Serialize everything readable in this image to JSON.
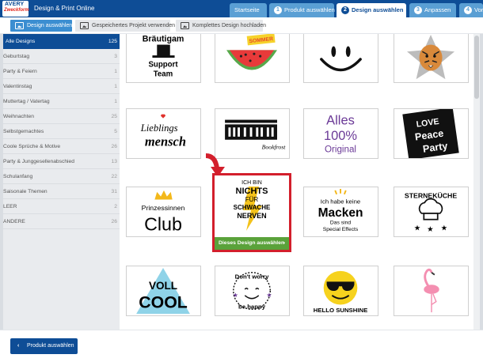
{
  "app": {
    "logo_line1": "AVERY",
    "logo_line2": "Zweckform",
    "title": "Design & Print Online"
  },
  "steps": [
    {
      "label": "Startseite",
      "number": ""
    },
    {
      "label": "Produkt auswählen",
      "number": "1"
    },
    {
      "label": "Design auswählen",
      "number": "2",
      "active": true
    },
    {
      "label": "Anpassen",
      "number": "3"
    },
    {
      "label": "Vors",
      "number": "4"
    }
  ],
  "toolbar": {
    "buttons": [
      {
        "label": "Design auswählen",
        "active": true
      },
      {
        "label": "Gespeichertes Projekt verwenden",
        "active": false
      },
      {
        "label": "Komplettes Design hochladen",
        "active": false
      }
    ]
  },
  "categories": [
    {
      "name": "Alle Designs",
      "count": "125",
      "active": true
    },
    {
      "name": "Geburtstag",
      "count": "3"
    },
    {
      "name": "Party & Feiern",
      "count": "1"
    },
    {
      "name": "Valentinstag",
      "count": "1"
    },
    {
      "name": "Muttertag / Vatertag",
      "count": "1"
    },
    {
      "name": "Weihnachten",
      "count": "25"
    },
    {
      "name": "Selbstgemachtes",
      "count": "5"
    },
    {
      "name": "Coole Sprüche & Motive",
      "count": "26"
    },
    {
      "name": "Party & Junggesellenabschied",
      "count": "13"
    },
    {
      "name": "Schulanfang",
      "count": "22"
    },
    {
      "name": "Saisonale Themen",
      "count": "31"
    },
    {
      "name": "LEER",
      "count": "2"
    },
    {
      "name": "ANDERE",
      "count": "26"
    }
  ],
  "designs": {
    "braeutigam": {
      "line1": "Bräutigam",
      "line2": "Support",
      "line3": "Team",
      "icon": "top-hat-icon"
    },
    "melon": {
      "tag": "SOMMER",
      "icon": "watermelon-icon"
    },
    "smiley": {
      "icon": "smiley-face-icon"
    },
    "tiger": {
      "icon": "tiger-star-icon"
    },
    "lieblingsmensch": {
      "line1": "Lieblings",
      "line2": "mensch"
    },
    "bookfrost": {
      "icon": "block-letters-icon",
      "tag": "Bookfrost"
    },
    "alles": {
      "line1": "Alles",
      "line2": "100%",
      "line3": "Original"
    },
    "lovepeace": {
      "line1": "LOVE",
      "line2": "Peace",
      "line3": "Party"
    },
    "prinzessinnen": {
      "line1": "Prinzessinnen",
      "line2": "Club",
      "icon": "crown-icon"
    },
    "nichts": {
      "line1": "ICH BIN",
      "line2": "NICHTS",
      "line3": "FÜR",
      "line4": "SCHWACHE",
      "line5": "NERVEN",
      "select_label": "Dieses Design auswählen",
      "chevron": "›"
    },
    "macken": {
      "line1": "Ich habe keine",
      "line2": "Macken",
      "line3": "Das sind",
      "line4": "Special Effects"
    },
    "sterne": {
      "line1": "STERNEKÜCHE",
      "icon": "chef-hat-icon"
    },
    "voll": {
      "line1": "VOLL",
      "line2": "COOL"
    },
    "dontworry": {
      "line1": "Don't worry",
      "line2": "be happy"
    },
    "sunshine": {
      "line1": "HELLO SUNSHINE",
      "icon": "sunglasses-smiley-icon"
    },
    "flamingo": {
      "icon": "flamingo-icon"
    }
  },
  "footer": {
    "back_label": "Produkt auswählen",
    "chevron": "‹"
  },
  "colors": {
    "brand_blue": "#0e4d96",
    "tab_blue": "#5a9fd4",
    "toolbar_active": "#3b8ed1",
    "highlight_red": "#d31f2c",
    "select_green": "#5aa23a"
  }
}
